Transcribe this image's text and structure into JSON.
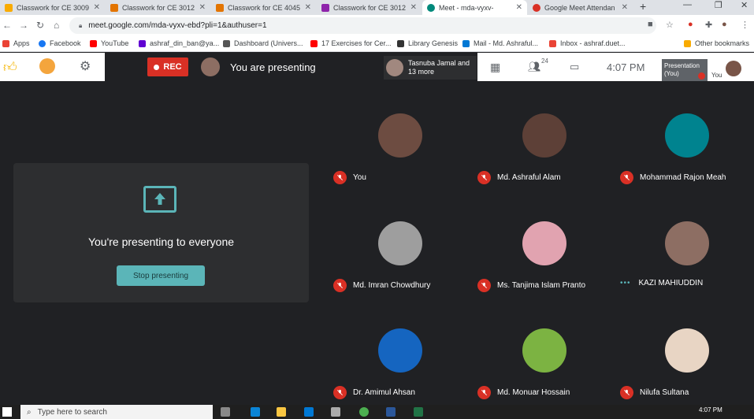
{
  "browser": {
    "tabs": [
      {
        "label": "Classwork for CE 3009",
        "fav_color": "#f9ab00"
      },
      {
        "label": "Classwork for CE 3012",
        "fav_color": "#e37400"
      },
      {
        "label": "Classwork for CE 4045",
        "fav_color": "#e37400"
      },
      {
        "label": "Classwork for CE 3012",
        "fav_color": "#8e24aa"
      },
      {
        "label": "Meet - mda-vyxv-",
        "fav_color": "#00897b"
      },
      {
        "label": "Google Meet Attendan",
        "fav_color": "#d93025"
      }
    ],
    "url": "meet.google.com/mda-vyxv-ebd?pli=1&authuser=1",
    "bookmarks": [
      {
        "label": "Apps",
        "color": "#ea4335"
      },
      {
        "label": "Facebook",
        "color": "#1877f2"
      },
      {
        "label": "YouTube",
        "color": "#ff0000"
      },
      {
        "label": "ashraf_din_ban@ya...",
        "color": "#6001d2"
      },
      {
        "label": "Dashboard (Univers...",
        "color": "#555555"
      },
      {
        "label": "17 Exercises for Cer...",
        "color": "#ff0000"
      },
      {
        "label": "Library Genesis",
        "color": "#333333"
      },
      {
        "label": "Mail - Md. Ashraful...",
        "color": "#0078d4"
      },
      {
        "label": "Inbox - ashraf.duet...",
        "color": "#ea4335"
      }
    ],
    "other_bookmarks": "Other bookmarks"
  },
  "meet": {
    "rec_label": "REC",
    "presenting_label": "You are presenting",
    "participants_preview": "Tasnuba Jamal and 13 more",
    "participant_count": "24",
    "time": "4:07 PM",
    "presentation_tile": "Presentation (You)",
    "you_label": "You",
    "card_text": "You're presenting to everyone",
    "stop_label": "Stop presenting",
    "participants": [
      {
        "name": "You",
        "color": "#6d4c41",
        "muted": true
      },
      {
        "name": "Md. Ashraful Alam",
        "color": "#5d4037",
        "muted": true
      },
      {
        "name": "Mohammad Rajon Meah",
        "color": "#00838f",
        "muted": true
      },
      {
        "name": "Md. Imran Chowdhury",
        "color": "#9e9e9e",
        "muted": true
      },
      {
        "name": "Ms. Tanjima Islam Pranto",
        "color": "#e1a3b0",
        "muted": true
      },
      {
        "name": "KAZI MAHIUDDIN",
        "color": "#8d6e63",
        "muted": false
      },
      {
        "name": "Dr. Amimul Ahsan",
        "color": "#1565c0",
        "muted": true
      },
      {
        "name": "Md. Monuar Hossain",
        "color": "#7cb342",
        "muted": true
      },
      {
        "name": "Nilufa Sultana",
        "color": "#e8d5c4",
        "muted": true
      }
    ]
  },
  "taskbar": {
    "search_placeholder": "Type here to search",
    "time": "4:07 PM"
  }
}
